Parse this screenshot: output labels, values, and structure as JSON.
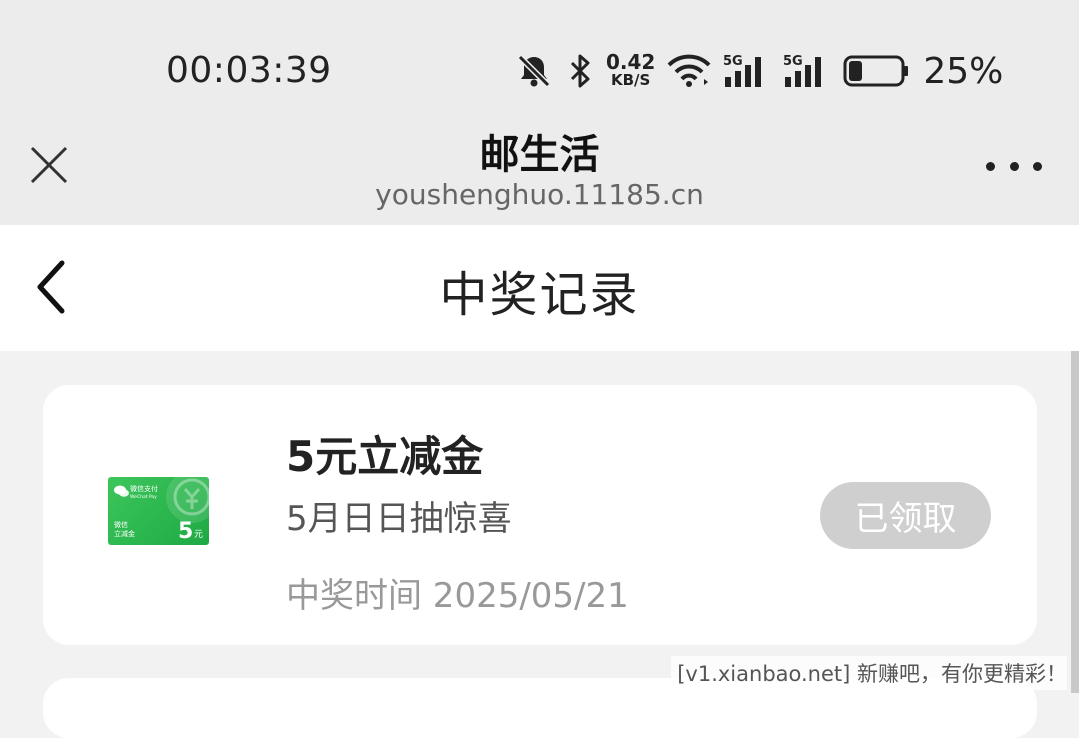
{
  "status_bar": {
    "time": "00:03:39",
    "net_speed_value": "0.42",
    "net_speed_unit": "KB/S",
    "signal1_label": "5G",
    "signal2_label": "5G",
    "battery_percent": "25%",
    "battery_level": 0.25,
    "icons": [
      "mute-bell-icon",
      "bluetooth-icon",
      "wifi-icon",
      "signal-icon",
      "signal-icon",
      "battery-icon"
    ]
  },
  "title_bar": {
    "title": "邮生活",
    "url": "youshenghuo.11185.cn",
    "close_icon": "close-icon",
    "more_icon": "more-icon"
  },
  "nav": {
    "title": "中奖记录",
    "back_icon": "back-icon"
  },
  "prize_list": [
    {
      "title": "5元立减金",
      "subtitle": "5月日日抽惊喜",
      "time": "中奖时间 2025/05/21",
      "status": "已领取",
      "coupon": {
        "brand_line1": "微信支付",
        "brand_line2": "WeChat Pay",
        "label_line1": "微信",
        "label_line2": "立减金",
        "amount": "5",
        "unit": "元"
      }
    }
  ],
  "watermark": "[v1.xianbao.net] 新赚吧，有你更精彩！",
  "colors": {
    "header_bg": "#ececec",
    "page_bg": "#f2f2f2",
    "coupon_green": "#26b14c",
    "claimed_bg": "#cfcfcf"
  }
}
